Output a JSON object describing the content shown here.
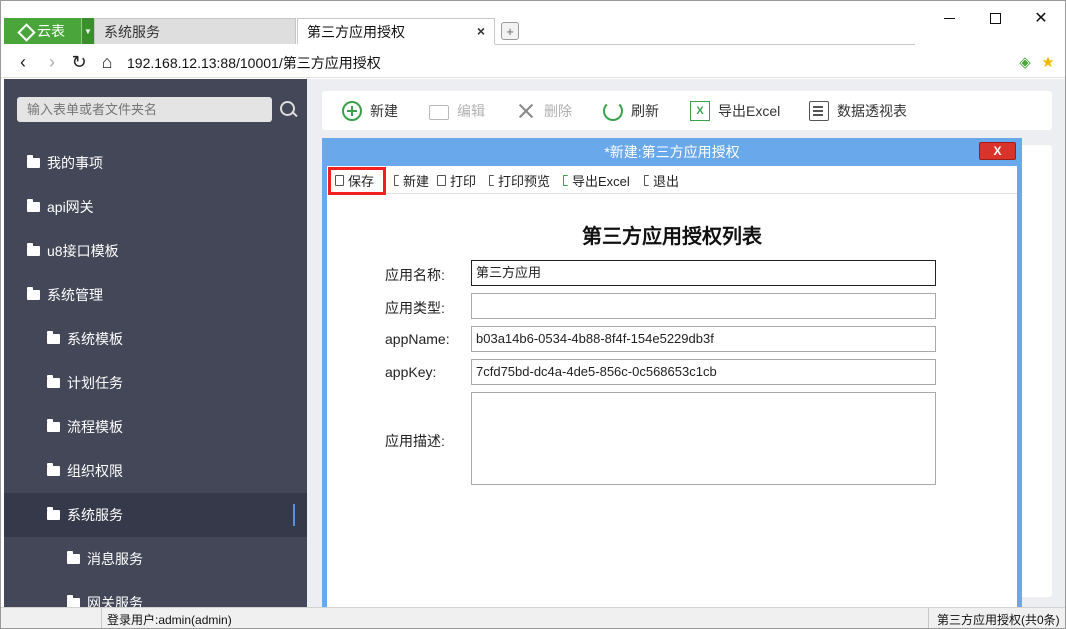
{
  "browser": {
    "logo_label": "云表",
    "tabs": [
      {
        "label": "系统服务"
      },
      {
        "label": "第三方应用授权"
      }
    ],
    "tab_close": "×",
    "new_tab": "+",
    "address": "192.168.12.13:88/10001/第三方应用授权"
  },
  "sidebar": {
    "search_placeholder": "输入表单或者文件夹名",
    "items": [
      {
        "label": "我的事项",
        "level": 0
      },
      {
        "label": "api网关",
        "level": 0
      },
      {
        "label": "u8接口模板",
        "level": 0
      },
      {
        "label": "系统管理",
        "level": 0
      },
      {
        "label": "系统模板",
        "level": 1
      },
      {
        "label": "计划任务",
        "level": 1
      },
      {
        "label": "流程模板",
        "level": 1
      },
      {
        "label": "组织权限",
        "level": 1
      },
      {
        "label": "系统服务",
        "level": 1,
        "active": true
      },
      {
        "label": "消息服务",
        "level": 2
      },
      {
        "label": "网关服务",
        "level": 2
      }
    ]
  },
  "toolbar": {
    "new_label": "新建",
    "edit_label": "编辑",
    "delete_label": "删除",
    "refresh_label": "刷新",
    "export_label": "导出Excel",
    "pivot_label": "数据透视表"
  },
  "dialog": {
    "title": "*新建:第三方应用授权",
    "close_label": "X",
    "toolbar": {
      "save_label": "保存",
      "new_label": "新建",
      "print_label": "打印",
      "print_preview_label": "打印预览",
      "export_label": "导出Excel",
      "exit_label": "退出"
    },
    "form_title": "第三方应用授权列表",
    "fields": {
      "app_name_label": "应用名称:",
      "app_name_value": "第三方应用",
      "app_type_label": "应用类型:",
      "app_type_value": "",
      "appname_label": "appName:",
      "appname_value": "b03a14b6-0534-4b88-8f4f-154e5229db3f",
      "appkey_label": "appKey:",
      "appkey_value": "7cfd75bd-dc4a-4de5-856c-0c568653c1cb",
      "desc_label": "应用描述:"
    }
  },
  "status": {
    "user": "登录用户:admin(admin)",
    "record_info": "第三方应用授权(共0条)"
  },
  "colors": {
    "brand_green": "#4aa63a",
    "sidebar_bg": "#434757",
    "dialog_border": "#6aa8ec",
    "highlight_red": "#f41f1f"
  }
}
